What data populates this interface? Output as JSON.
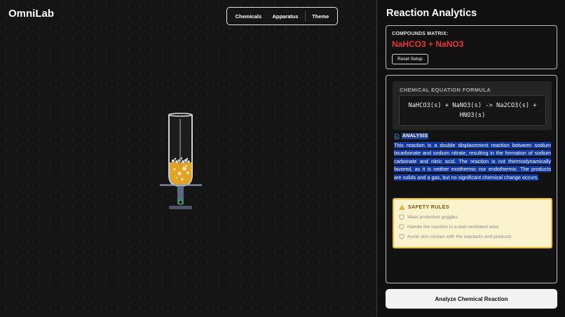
{
  "app": {
    "name": "OmniLab"
  },
  "nav": {
    "items": [
      "Chemicals",
      "Apparatus",
      "Theme"
    ]
  },
  "panel": {
    "title": "Reaction Analytics",
    "compounds_label": "COMPOUNDS MATRIX:",
    "compounds_value": "NaHCO3 + NaNO3",
    "reset_label": "Reset Setup",
    "formula_label": "CHEMICAL EQUATION FORMULA",
    "formula": "NaHCO3(s) + NaNO3(s) -> Na2CO3(s) + HNO3(s)",
    "analysis_label": "ANALYSIS",
    "analysis_text": "This reaction is a double displacement reaction between sodium bicarbonate and sodium nitrate, resulting in the formation of sodium carbonate and nitric acid. The reaction is not thermodynamically favored, as it is neither exothermic nor endothermic. The products are solids and a gas, but no significant chemical change occurs.",
    "safety_title": "SAFETY RULES",
    "safety_rules": [
      "Wear protective goggles",
      "Handle the reaction in a well-ventilated area",
      "Avoid skin contact with the reactants and products"
    ],
    "analyze_label": "Analyze Chemical Reaction"
  },
  "colors": {
    "compound_red": "#e63535",
    "liquid": "#e0a323",
    "indicator_green": "#22c55e",
    "safety_bg": "#fbf3cd",
    "safety_border": "#f4c21f",
    "selection_blue": "#123aa6"
  },
  "icons": {
    "analysis": "document-icon",
    "safety": "warning-triangle-icon",
    "rule": "shield-icon"
  }
}
